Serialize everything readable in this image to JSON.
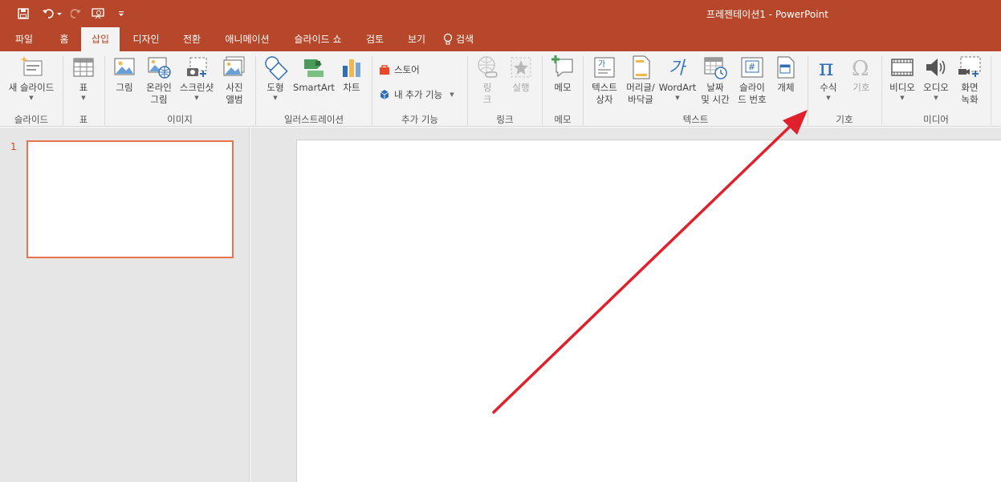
{
  "app": {
    "title": "프레젠테이션1 - PowerPoint"
  },
  "colors": {
    "accent": "#b7472a",
    "ribbon_bg": "#f3f3f3",
    "workspace_bg": "#e6e6e6",
    "slide_selected_border": "#e8734d",
    "annotation_arrow": "#e0202a"
  },
  "quick_access": {
    "save_icon": "save-icon",
    "undo_icon": "undo-icon",
    "redo_icon": "redo-icon",
    "present_icon": "present-from-start-icon",
    "customize_icon": "customize-toolbar-icon"
  },
  "tabs": [
    "파일",
    "홈",
    "삽입",
    "디자인",
    "전환",
    "애니메이션",
    "슬라이드 쇼",
    "검토",
    "보기"
  ],
  "active_tab": "삽입",
  "tell_me": "검색",
  "ribbon": {
    "groups": {
      "slides": "슬라이드",
      "table": "표",
      "images": "이미지",
      "illustrations": "일러스트레이션",
      "addins": "추가 기능",
      "links": "링크",
      "comments": "메모",
      "text": "텍스트",
      "symbols": "기호",
      "media": "미디어"
    },
    "buttons": {
      "new_slide": "새 슬라이드",
      "table": "표",
      "picture": "그림",
      "online_picture": "온라인\n그림",
      "screenshot": "스크린샷",
      "photo_album": "사진\n앨범",
      "shapes": "도형",
      "smartart": "SmartArt",
      "chart": "차트",
      "store": "스토어",
      "my_addins": "내 추가 기능",
      "link": "링\n크",
      "action": "실행",
      "comment": "메모",
      "textbox": "텍스트\n상자",
      "header_footer": "머리글/\n바닥글",
      "wordart": "WordArt",
      "date_time": "날짜\n및 시간",
      "slide_number": "슬라이\n드 번호",
      "object": "개체",
      "equation": "수식",
      "symbol": "기호",
      "video": "비디오",
      "audio": "오디오",
      "screen_recording": "화면\n녹화"
    }
  },
  "slides_pane": {
    "slide_number": "1"
  }
}
